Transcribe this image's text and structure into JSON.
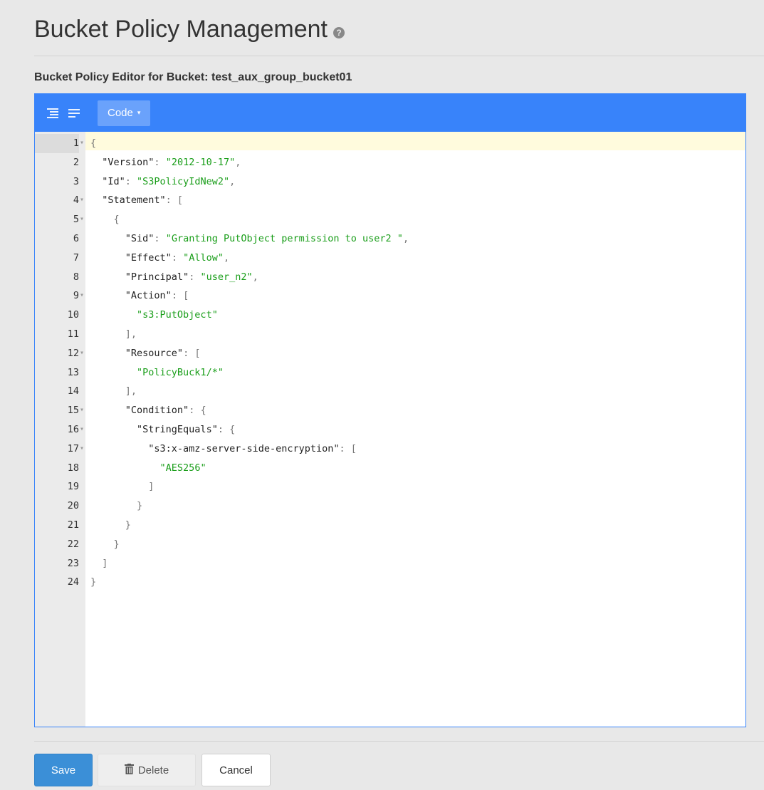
{
  "header": {
    "title": "Bucket Policy Management",
    "help_icon": "question-circle-icon"
  },
  "editor": {
    "heading": "Bucket Policy Editor for Bucket: test_aux_group_bucket01",
    "menu": {
      "format_icon": "format-indent-icon",
      "compact_icon": "compact-lines-icon",
      "mode_label": "Code",
      "mode_caret": "▾"
    },
    "lines": [
      {
        "n": "1",
        "fold": true,
        "text": "{"
      },
      {
        "n": "2",
        "fold": false,
        "text": "  \"Version\": \"2012-10-17\","
      },
      {
        "n": "3",
        "fold": false,
        "text": "  \"Id\": \"S3PolicyIdNew2\","
      },
      {
        "n": "4",
        "fold": true,
        "text": "  \"Statement\": ["
      },
      {
        "n": "5",
        "fold": true,
        "text": "    {"
      },
      {
        "n": "6",
        "fold": false,
        "text": "      \"Sid\": \"Granting PutObject permission to user2 \","
      },
      {
        "n": "7",
        "fold": false,
        "text": "      \"Effect\": \"Allow\","
      },
      {
        "n": "8",
        "fold": false,
        "text": "      \"Principal\": \"user_n2\","
      },
      {
        "n": "9",
        "fold": true,
        "text": "      \"Action\": ["
      },
      {
        "n": "10",
        "fold": false,
        "text": "        \"s3:PutObject\""
      },
      {
        "n": "11",
        "fold": false,
        "text": "      ],"
      },
      {
        "n": "12",
        "fold": true,
        "text": "      \"Resource\": ["
      },
      {
        "n": "13",
        "fold": false,
        "text": "        \"PolicyBuck1/*\""
      },
      {
        "n": "14",
        "fold": false,
        "text": "      ],"
      },
      {
        "n": "15",
        "fold": true,
        "text": "      \"Condition\": {"
      },
      {
        "n": "16",
        "fold": true,
        "text": "        \"StringEquals\": {"
      },
      {
        "n": "17",
        "fold": true,
        "text": "          \"s3:x-amz-server-side-encryption\": ["
      },
      {
        "n": "18",
        "fold": false,
        "text": "            \"AES256\""
      },
      {
        "n": "19",
        "fold": false,
        "text": "          ]"
      },
      {
        "n": "20",
        "fold": false,
        "text": "        }"
      },
      {
        "n": "21",
        "fold": false,
        "text": "      }"
      },
      {
        "n": "22",
        "fold": false,
        "text": "    }"
      },
      {
        "n": "23",
        "fold": false,
        "text": "  ]"
      },
      {
        "n": "24",
        "fold": false,
        "text": "}"
      }
    ]
  },
  "actions": {
    "save_label": "Save",
    "delete_label": "Delete",
    "delete_icon": "trash-icon",
    "cancel_label": "Cancel"
  },
  "colors": {
    "editor_accent": "#3883fa",
    "save_button": "#3b8fd7",
    "string_value": "#1a9e1a",
    "active_line": "#fffbdd"
  }
}
